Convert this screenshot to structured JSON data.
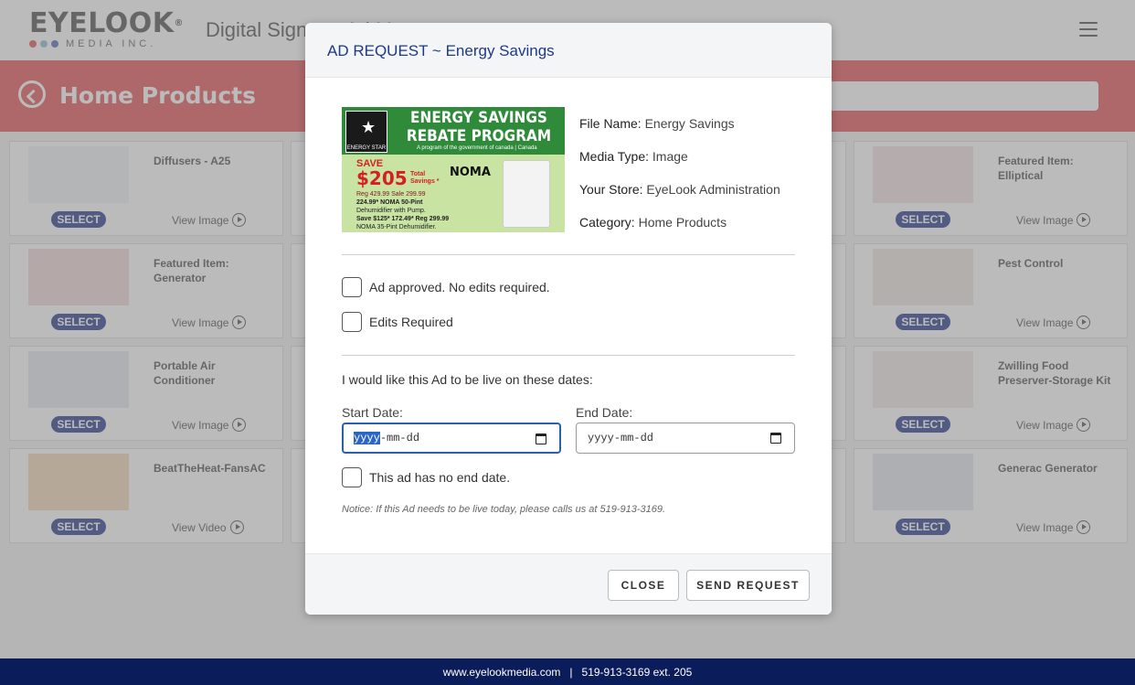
{
  "app": {
    "logo_text": "EYELOOK",
    "logo_sub": "MEDIA INC.",
    "title": "Digital Signage Ad Manager",
    "page_title": "Home Products"
  },
  "colors": {
    "brand_red": "#e4585c",
    "brand_navy": "#0b1c5a",
    "accent_blue": "#1d3a8a",
    "select_blue": "#2a3f8f",
    "logo_dots": [
      "#e4585c",
      "#8fc1d9",
      "#5b6cb8",
      "#6a4fa0"
    ]
  },
  "cards": [
    {
      "title": "Diffusers - A25",
      "select": "SELECT",
      "view": "View Image"
    },
    {
      "title": "Featured Item: Elliptical",
      "select": "SELECT",
      "view": "View Image"
    },
    {
      "title": "Featured Item: Generator",
      "select": "SELECT",
      "view": "View Image"
    },
    {
      "title": "Pest Control",
      "select": "SELECT",
      "view": "View Image"
    },
    {
      "title": "Portable Air Conditioner",
      "select": "SELECT",
      "view": "View Image"
    },
    {
      "title": "Zwilling Food Preserver-Storage Kit",
      "select": "SELECT",
      "view": "View Image"
    },
    {
      "title": "BeatTheHeat-FansAC",
      "select": "SELECT",
      "view": "View Video"
    },
    {
      "title": "Generac Generator",
      "select": "SELECT",
      "view": "View Image"
    }
  ],
  "footer": {
    "website": "www.eyelookmedia.com",
    "separator": "|",
    "phone": "519-913-3169 ext. 205"
  },
  "modal": {
    "title": "AD REQUEST ~ Energy Savings",
    "ad_preview": {
      "headline_1": "ENERGY SAVINGS",
      "headline_2": "REBATE PROGRAM",
      "sub": "A program of the government of canada | Canada",
      "badge": "ENERGY STAR",
      "save": "SAVE",
      "amount": "$205",
      "total_1": "Total",
      "total_2": "Savings *",
      "reg_line": "Reg 429.99  Sale 299.99",
      "price_line": "224.99*  NOMA 50-Pint",
      "desc_line": "Dehumidifier with Pump.",
      "save2_line": "Save $125* 172.49* Reg 299.99",
      "desc2_line": "NOMA 35-Pint Dehumidifier.",
      "brand": "NOMA"
    },
    "info": {
      "file_name_label": "File Name:",
      "file_name": "Energy Savings",
      "media_type_label": "Media Type:",
      "media_type": "Image",
      "store_label": "Your Store:",
      "store": "EyeLook Administration",
      "category_label": "Category:",
      "category": "Home Products"
    },
    "checks": {
      "approved": "Ad approved. No edits required.",
      "edits": "Edits Required",
      "no_end": "This ad has no end date."
    },
    "dates": {
      "prompt": "I would like this Ad to be live on these dates:",
      "start_label": "Start Date:",
      "end_label": "End Date:",
      "start_seg_year": "yyyy",
      "start_rest": "-mm-dd",
      "end_placeholder": "yyyy-mm-dd"
    },
    "notice": "Notice: If this Ad needs to be live today, please calls us at 519-913-3169.",
    "buttons": {
      "close": "CLOSE",
      "send": "SEND REQUEST"
    }
  }
}
